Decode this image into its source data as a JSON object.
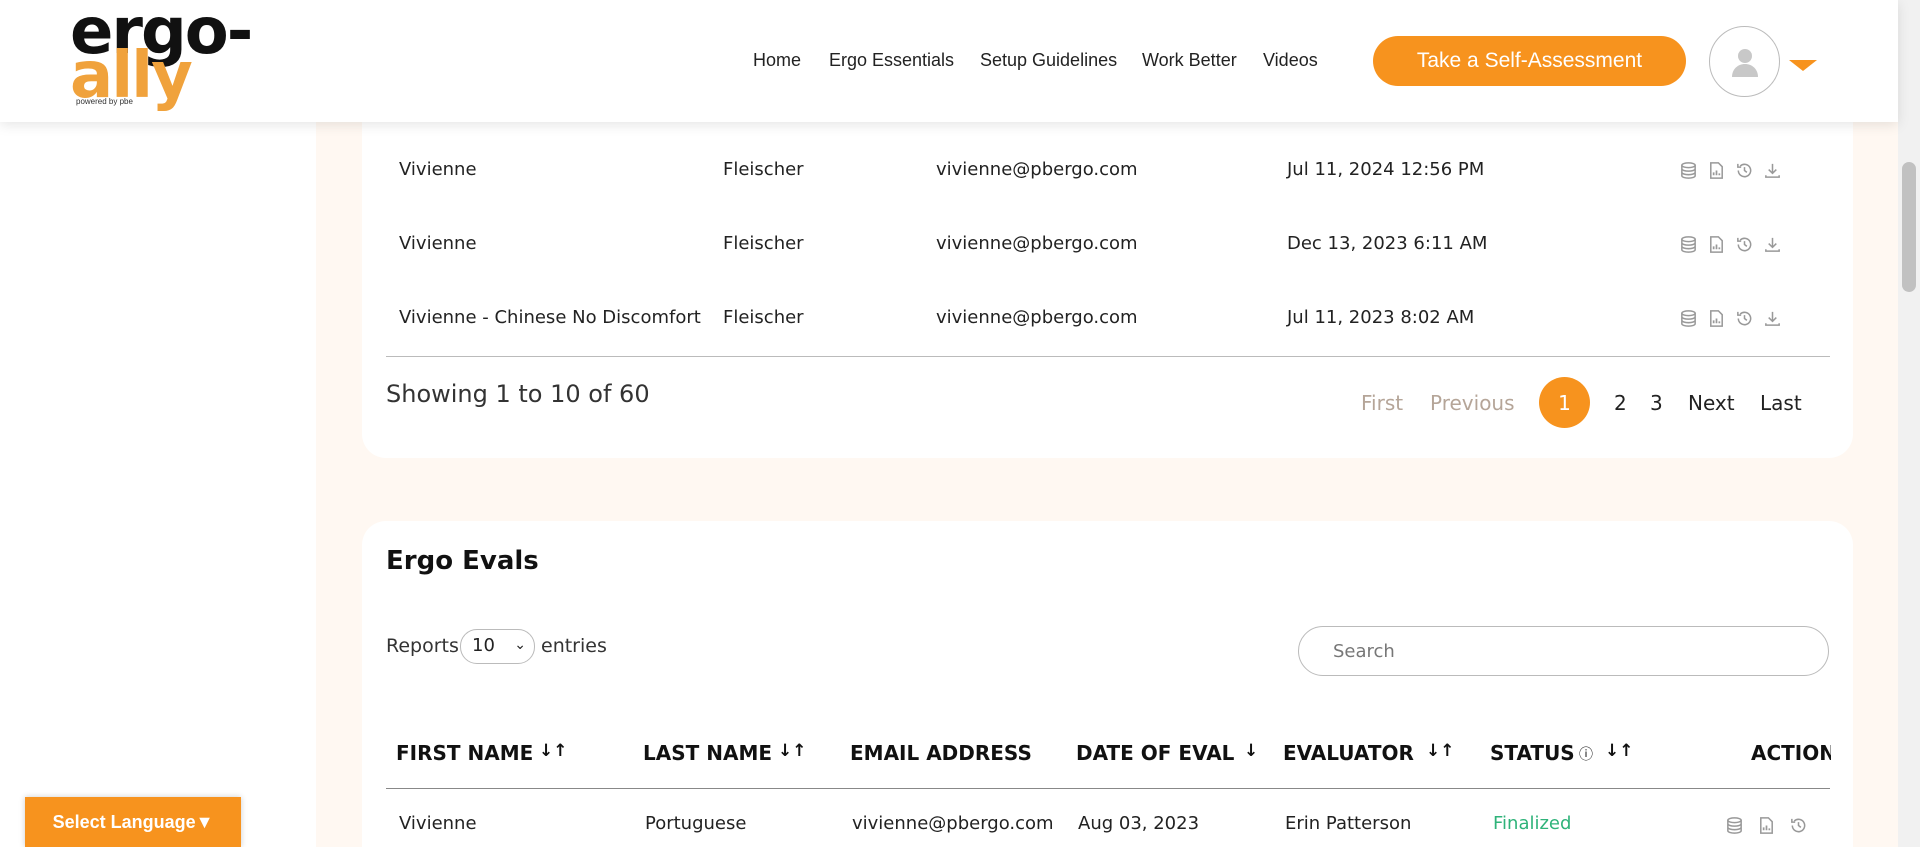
{
  "brand": {
    "logo_line1": "ergo-",
    "logo_line2": "ally",
    "logo_tagline": "powered by pbe"
  },
  "nav": {
    "items": [
      "Home",
      "Ergo Essentials",
      "Setup Guidelines",
      "Work Better",
      "Videos"
    ],
    "cta_label": "Take a Self-Assessment"
  },
  "table1": {
    "rows": [
      {
        "first": "Vivienne",
        "last": "Fleischer",
        "email": "vivienne@pbergo.com",
        "date": "Jul 11, 2024 12:56 PM"
      },
      {
        "first": "Vivienne",
        "last": "Fleischer",
        "email": "vivienne@pbergo.com",
        "date": "Dec 13, 2023 6:11 AM"
      },
      {
        "first": "Vivienne - Chinese No Discomfort",
        "last": "Fleischer",
        "email": "vivienne@pbergo.com",
        "date": "Jul 11, 2023 8:02 AM"
      }
    ],
    "row_icons": [
      "database-icon",
      "report-icon",
      "history-icon",
      "download-icon"
    ],
    "showing": "Showing 1 to 10 of 60",
    "pagination": {
      "first": "First",
      "previous": "Previous",
      "pages": [
        "1",
        "2",
        "3"
      ],
      "active": "1",
      "next": "Next",
      "last": "Last"
    }
  },
  "ergo_evals": {
    "title": "Ergo Evals",
    "reports_label": "Reports",
    "entries_value": "10",
    "entries_label": "entries",
    "search_placeholder": "Search",
    "columns": [
      "FIRST NAME",
      "LAST NAME",
      "EMAIL ADDRESS",
      "DATE OF EVAL",
      "EVALUATOR",
      "STATUS",
      "ACTION"
    ],
    "rows": [
      {
        "first": "Vivienne",
        "last": "Portuguese",
        "email": "vivienne@pbergo.com",
        "date": "Aug 03, 2023",
        "evaluator": "Erin Patterson",
        "status": "Finalized"
      }
    ],
    "row_icons": [
      "database-icon",
      "report-icon",
      "history-icon"
    ]
  },
  "language": {
    "label": "Select Language▼"
  },
  "colors": {
    "accent": "#f7931e",
    "status_finalized": "#2fb37a",
    "page_bg": "#fff8f2"
  }
}
